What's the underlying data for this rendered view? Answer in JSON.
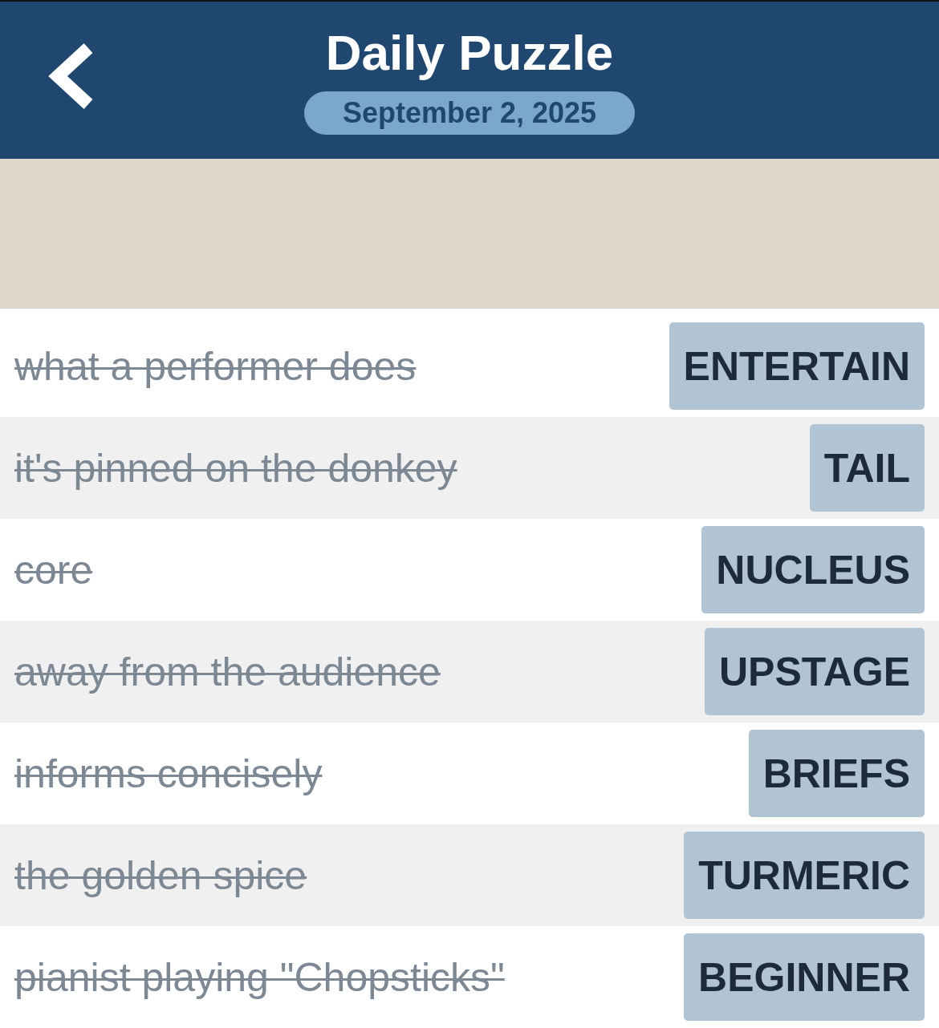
{
  "header": {
    "title": "Daily Puzzle",
    "date": "September 2, 2025"
  },
  "clues": [
    {
      "clue": "what a performer does",
      "answer": "ENTERTAIN",
      "solved": true
    },
    {
      "clue": "it's pinned on the donkey",
      "answer": "TAIL",
      "solved": true
    },
    {
      "clue": "core",
      "answer": "NUCLEUS",
      "solved": true
    },
    {
      "clue": "away from the audience",
      "answer": "UPSTAGE",
      "solved": true
    },
    {
      "clue": "informs concisely",
      "answer": "BRIEFS",
      "solved": true
    },
    {
      "clue": "the golden spice",
      "answer": "TURMERIC",
      "solved": true
    },
    {
      "clue": "pianist playing \"Chopsticks\"",
      "answer": "BEGINNER",
      "solved": true
    }
  ]
}
